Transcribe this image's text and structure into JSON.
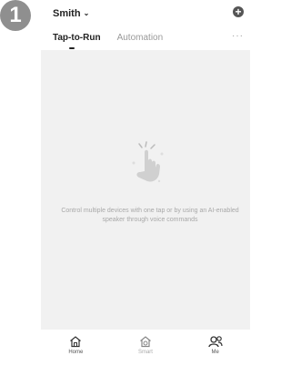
{
  "step_badge": "1",
  "header": {
    "home_name": "Smith",
    "add_icon": "plus-circle-icon"
  },
  "tabs": [
    {
      "label": "Tap-to-Run",
      "active": true
    },
    {
      "label": "Automation",
      "active": false
    }
  ],
  "more_label": "···",
  "empty_state": {
    "illustration": "tap-hand-icon",
    "message": "Control multiple devices with one tap or by using an AI-enabled speaker through voice commands"
  },
  "bottom_nav": [
    {
      "label": "Home",
      "icon": "home-icon"
    },
    {
      "label": "Smart",
      "icon": "smart-icon"
    },
    {
      "label": "Me",
      "icon": "me-icon"
    }
  ]
}
